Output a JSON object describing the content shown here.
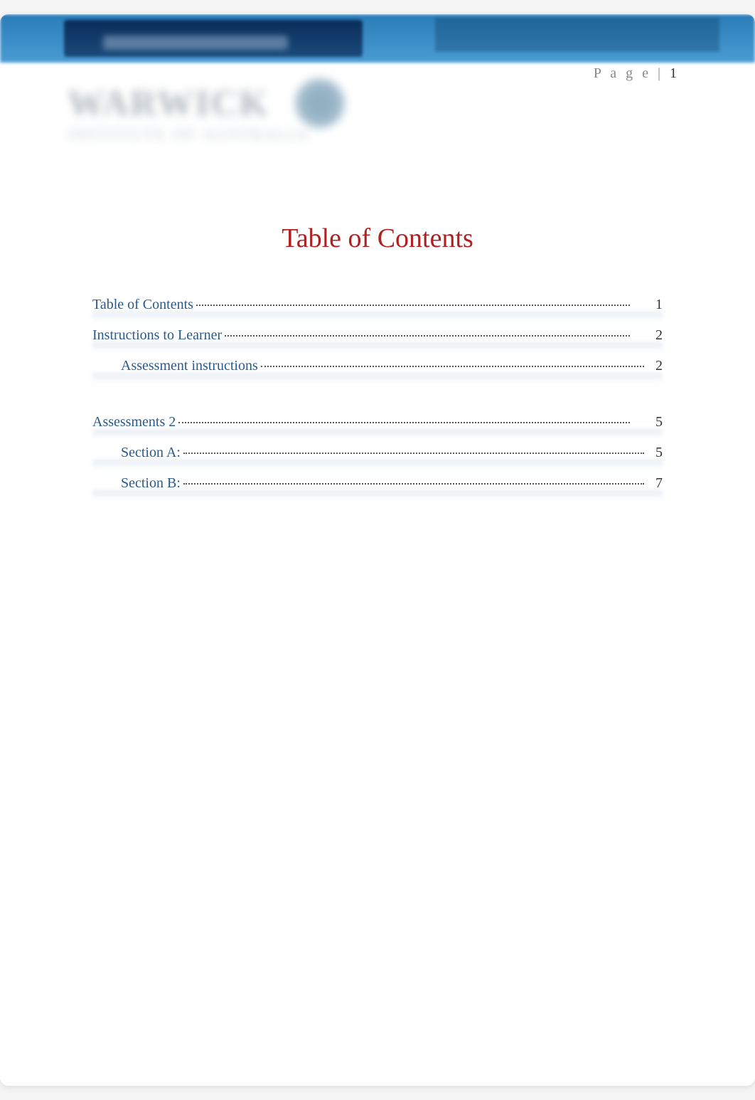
{
  "pageNumber": {
    "label": "P a g e |",
    "value": "1"
  },
  "logo": {
    "main": "WARWICK",
    "sub": "INSTITUTE OF AUSTRALIA"
  },
  "title": "Table of Contents",
  "toc": [
    {
      "label": "Table of Contents",
      "page": "1",
      "level": 0
    },
    {
      "label": "Instructions  to Learner",
      "page": "2",
      "level": 0
    },
    {
      "label": "Assessment instructions",
      "page": "2",
      "level": 1
    },
    {
      "gap": true
    },
    {
      "label": "Assessments 2",
      "page": "5",
      "level": 0
    },
    {
      "label": "Section A:",
      "page": "5",
      "level": 1
    },
    {
      "label": "Section B:",
      "page": "7",
      "level": 1
    }
  ]
}
